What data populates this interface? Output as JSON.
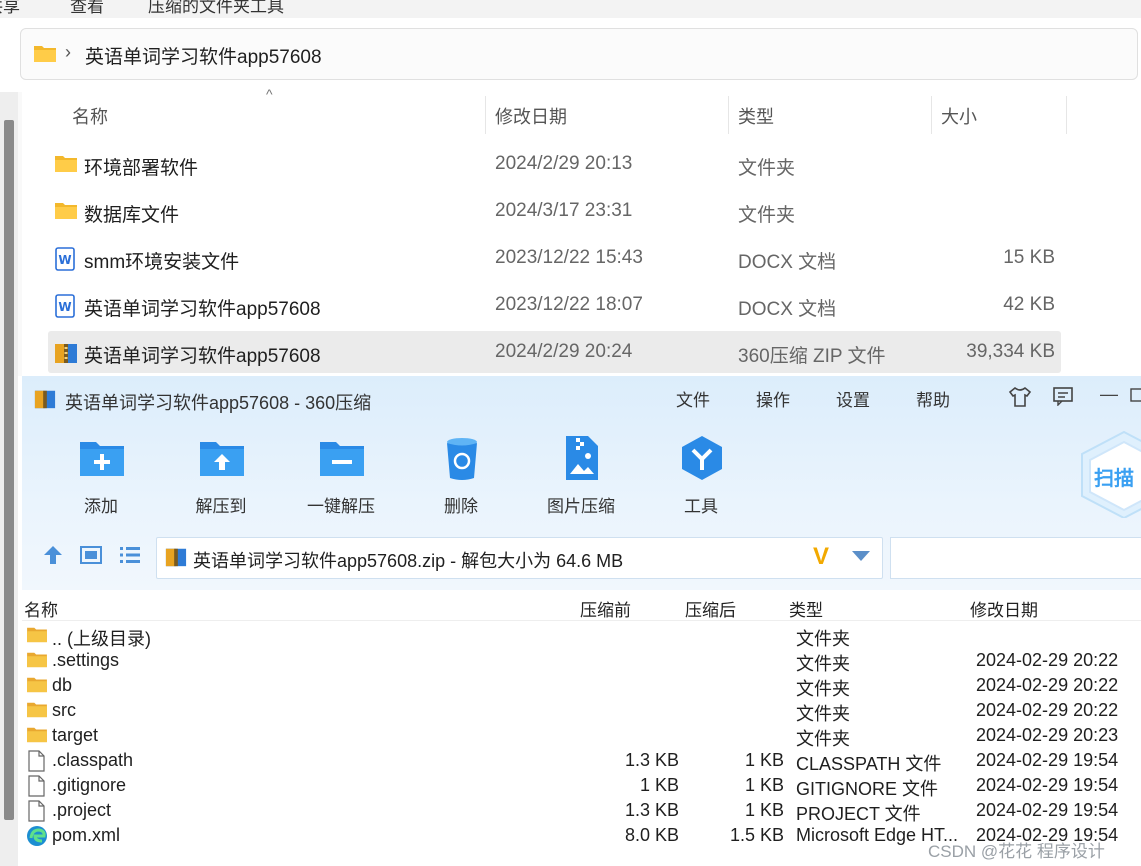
{
  "explorer": {
    "menu": [
      "共享",
      "查看",
      "压缩的文件夹工具"
    ],
    "address": {
      "path": "英语单词学习软件app57608"
    },
    "columns": {
      "name": "名称",
      "date": "修改日期",
      "type": "类型",
      "size": "大小"
    },
    "rows": [
      {
        "icon": "folder-icon",
        "name": "环境部署软件",
        "date": "2024/2/29 20:13",
        "type": "文件夹",
        "size": ""
      },
      {
        "icon": "folder-icon",
        "name": "数据库文件",
        "date": "2024/3/17 23:31",
        "type": "文件夹",
        "size": ""
      },
      {
        "icon": "word-doc-icon",
        "name": "smm环境安装文件",
        "date": "2023/12/22 15:43",
        "type": "DOCX 文档",
        "size": "15 KB"
      },
      {
        "icon": "word-doc-icon",
        "name": "英语单词学习软件app57608",
        "date": "2023/12/22 18:07",
        "type": "DOCX 文档",
        "size": "42 KB"
      },
      {
        "icon": "zip-archive-icon",
        "name": "英语单词学习软件app57608",
        "date": "2024/2/29 20:24",
        "type": "360压缩 ZIP 文件",
        "size": "39,334 KB"
      }
    ]
  },
  "zip": {
    "title": "英语单词学习软件app57608 - 360压缩",
    "menu": {
      "file": "文件",
      "ops": "操作",
      "settings": "设置",
      "help": "帮助"
    },
    "toolbar": {
      "add": "添加",
      "extract_to": "解压到",
      "one_click": "一键解压",
      "delete": "删除",
      "image_compress": "图片压缩",
      "tools": "工具"
    },
    "scan_label": "扫描",
    "path": "英语单词学习软件app57608.zip - 解包大小为 64.6 MB",
    "columns": {
      "name": "名称",
      "before": "压缩前",
      "after": "压缩后",
      "type": "类型",
      "date": "修改日期"
    },
    "rows": [
      {
        "icon": "folder-icon",
        "name": ".. (上级目录)",
        "before": "",
        "after": "",
        "type": "文件夹",
        "date": ""
      },
      {
        "icon": "folder-icon",
        "name": ".settings",
        "before": "",
        "after": "",
        "type": "文件夹",
        "date": "2024-02-29 20:22"
      },
      {
        "icon": "folder-icon",
        "name": "db",
        "before": "",
        "after": "",
        "type": "文件夹",
        "date": "2024-02-29 20:22"
      },
      {
        "icon": "folder-icon",
        "name": "src",
        "before": "",
        "after": "",
        "type": "文件夹",
        "date": "2024-02-29 20:22"
      },
      {
        "icon": "folder-icon",
        "name": "target",
        "before": "",
        "after": "",
        "type": "文件夹",
        "date": "2024-02-29 20:23"
      },
      {
        "icon": "file-icon",
        "name": ".classpath",
        "before": "1.3 KB",
        "after": "1 KB",
        "type": "CLASSPATH 文件",
        "date": "2024-02-29 19:54"
      },
      {
        "icon": "file-icon",
        "name": ".gitignore",
        "before": "1 KB",
        "after": "1 KB",
        "type": "GITIGNORE 文件",
        "date": "2024-02-29 19:54"
      },
      {
        "icon": "file-icon",
        "name": ".project",
        "before": "1.3 KB",
        "after": "1 KB",
        "type": "PROJECT 文件",
        "date": "2024-02-29 19:54"
      },
      {
        "icon": "edge-icon",
        "name": "pom.xml",
        "before": "8.0 KB",
        "after": "1.5 KB",
        "type": "Microsoft Edge HT...",
        "date": "2024-02-29 19:54"
      }
    ]
  },
  "watermark": "CSDN @花花 程序设计"
}
